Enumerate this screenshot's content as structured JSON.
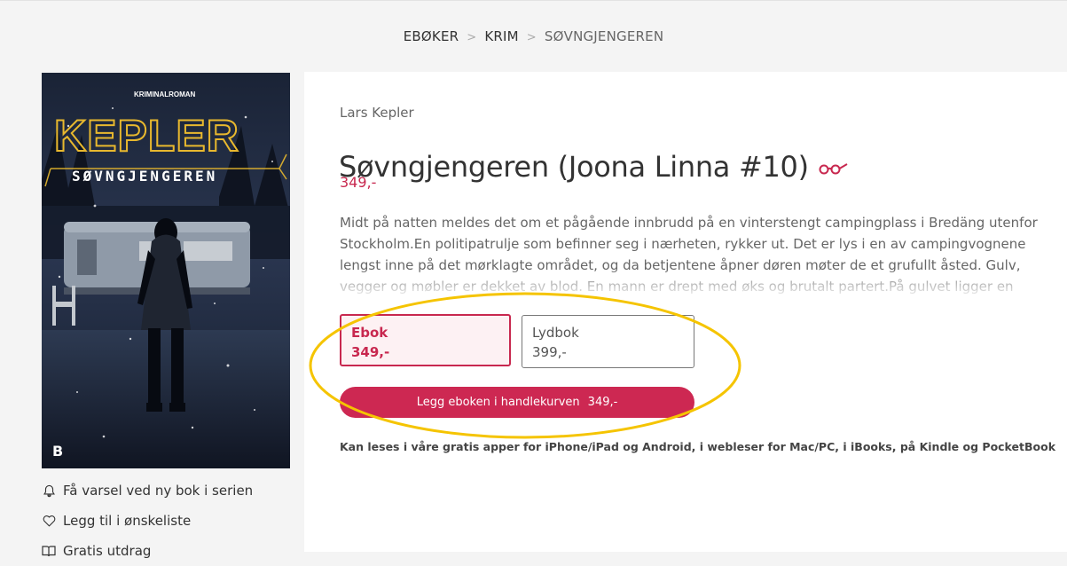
{
  "breadcrumb": {
    "items": [
      "EBØKER",
      "KRIM",
      "SØVNGJENGEREN"
    ],
    "separator": ">"
  },
  "cover": {
    "kicker": "KRIMINALROMAN",
    "author_text": "KEPLER",
    "title_text": "SØVNGJENGEREN",
    "publisher_mark": "B"
  },
  "side_actions": [
    {
      "icon": "bell-icon",
      "label": "Få varsel ved ny bok i serien"
    },
    {
      "icon": "heart-icon",
      "label": "Legg til i ønskeliste"
    },
    {
      "icon": "book-icon",
      "label": "Gratis utdrag"
    }
  ],
  "product": {
    "author": "Lars Kepler",
    "title": "Søvngjengeren (Joona Linna #10)",
    "title_icon": "glasses-icon",
    "price": "349,-",
    "description": "Midt på natten meldes det om et pågående innbrudd på en vinterstengt campingplass i Bredäng utenfor Stockholm.En politipatrulje som befinner seg i nærheten, rykker ut. Det er lys i en av campingvognene lengst inne på det mørklagte området, og da betjentene åpner døren møter de et grufullt åsted. Gulv, vegger og møbler er dekket av blod. En mann er drept med øks og brutalt partert.På gulvet ligger en ung mann og sover…"
  },
  "formats": [
    {
      "name": "Ebok",
      "price": "349,-",
      "selected": true
    },
    {
      "name": "Lydbok",
      "price": "399,-",
      "selected": false
    }
  ],
  "buy_button": {
    "label": "Legg eboken i handlekurven",
    "price": "349,-"
  },
  "read_info": "Kan leses i våre gratis apper for iPhone/iPad og Android, i webleser for Mac/PC, i iBooks, på Kindle og PocketBook",
  "colors": {
    "accent": "#cd2852",
    "highlight_ellipse": "#f5c400"
  }
}
